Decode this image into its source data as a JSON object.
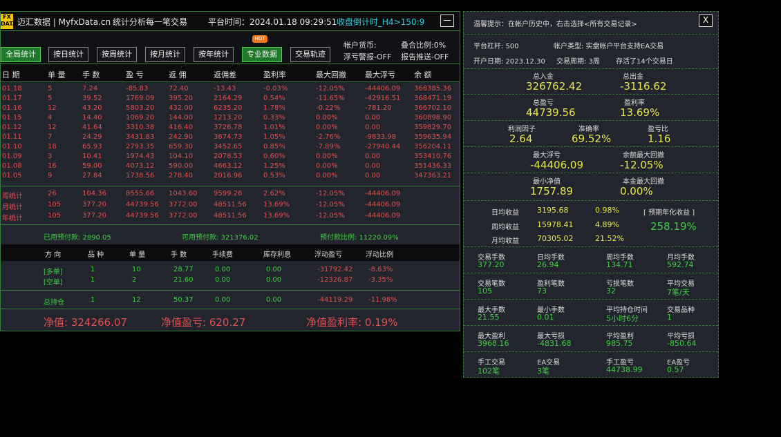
{
  "title": {
    "logo_top": "FX",
    "logo_bottom": "DATA",
    "app_name": "迈汇数据 | MyfxData.cn",
    "slogan": "统计分析每一笔交易",
    "server_time": "平台时间：2024.01.18 09:29:51",
    "countdown": "收盘倒计时_H4>150:9",
    "minimize": "—"
  },
  "buttons": [
    {
      "label": "全局统计",
      "active": true
    },
    {
      "label": "按日统计",
      "active": false
    },
    {
      "label": "按周统计",
      "active": false
    },
    {
      "label": "按月统计",
      "active": false
    },
    {
      "label": "按年统计",
      "active": false
    },
    {
      "label": "专业数据",
      "active": true
    },
    {
      "label": "交易轨迹",
      "active": false
    }
  ],
  "hot_badge": "HOT",
  "account_info": {
    "currency": "帐户货币:",
    "combine_ratio": "叠合比例:0%",
    "float_alert": "浮亏警报-OFF",
    "report_push": "报告推送-OFF"
  },
  "table": {
    "headers": [
      "日 期",
      "单 量",
      "手 数",
      "盈 亏",
      "返 佣",
      "返佣差",
      "盈利率",
      "最大回撤",
      "最大浮亏",
      "余 额"
    ],
    "rows": [
      [
        "01.18",
        "5",
        "7.24",
        "-85.83",
        "72.40",
        "-13.43",
        "-0.03%",
        "-12.05%",
        "-44406.09",
        "368385.36"
      ],
      [
        "01.17",
        "5",
        "39.52",
        "1769.09",
        "395.20",
        "2164.29",
        "0.54%",
        "-11.65%",
        "-42916.51",
        "368471.19"
      ],
      [
        "01.16",
        "12",
        "43.20",
        "5803.20",
        "432.00",
        "6235.20",
        "1.78%",
        "-0.22%",
        "-781.20",
        "366702.10"
      ],
      [
        "01.15",
        "4",
        "14.40",
        "1069.20",
        "144.00",
        "1213.20",
        "0.33%",
        "0.00%",
        "0.00",
        "360898.90"
      ],
      [
        "01.12",
        "12",
        "41.64",
        "3310.38",
        "416.40",
        "3726.78",
        "1.01%",
        "0.00%",
        "0.00",
        "359829.70"
      ],
      [
        "01.11",
        "7",
        "24.29",
        "3431.83",
        "242.90",
        "3674.73",
        "1.05%",
        "-2.76%",
        "-9833.98",
        "359635.94"
      ],
      [
        "01.10",
        "18",
        "65.93",
        "2793.35",
        "659.30",
        "3452.65",
        "0.85%",
        "-7.89%",
        "-27940.44",
        "356204.11"
      ],
      [
        "01.09",
        "3",
        "10.41",
        "1974.43",
        "104.10",
        "2078.53",
        "0.60%",
        "0.00%",
        "0.00",
        "353410.76"
      ],
      [
        "01.08",
        "16",
        "59.00",
        "4073.12",
        "590.00",
        "4663.12",
        "1.25%",
        "0.00%",
        "0.00",
        "351436.33"
      ],
      [
        "01.05",
        "9",
        "27.84",
        "1738.56",
        "278.40",
        "2016.96",
        "0.53%",
        "0.00%",
        "0.00",
        "347363.21"
      ]
    ],
    "summary": [
      [
        "周统计",
        "26",
        "104.36",
        "8555.66",
        "1043.60",
        "9599.26",
        "2.62%",
        "-12.05%",
        "-44406.09"
      ],
      [
        "月统计",
        "105",
        "377.20",
        "44739.56",
        "3772.00",
        "48511.56",
        "13.69%",
        "-12.05%",
        "-44406.09"
      ],
      [
        "年统计",
        "105",
        "377.20",
        "44739.56",
        "3772.00",
        "48511.56",
        "13.69%",
        "-12.05%",
        "-44406.09"
      ]
    ]
  },
  "margin": {
    "used": "已用预付款:  2890.05",
    "free": "可用预付款:  321376.02",
    "ratio": "预付款比例:  11220.09%"
  },
  "positions": {
    "headers": [
      "方 向",
      "品 种",
      "单 量",
      "手 数",
      "手续费",
      "库存利息",
      "浮动盈亏",
      "浮动比例"
    ],
    "rows": [
      [
        "[多单]",
        "1",
        "10",
        "28.77",
        "0.00",
        "0.00",
        "-31792.42",
        "-8.63%"
      ],
      [
        "[空单]",
        "1",
        "2",
        "21.60",
        "0.00",
        "0.00",
        "-12326.87",
        "-3.35%"
      ]
    ],
    "total": [
      "总持仓",
      "1",
      "12",
      "50.37",
      "0.00",
      "0.00",
      "-44119.29",
      "-11.98%"
    ]
  },
  "equity": {
    "net": "净值:  324266.07",
    "pnl": "净值盈亏:  620.27",
    "rate": "净值盈利率:  0.19%"
  },
  "right": {
    "tip": "温馨提示：在帐户历史中，右击选择<所有交易记录>",
    "close": "X",
    "leverage": "平台杠杆:  500",
    "acct_type": "帐户类型:  实盘帐户",
    "ea_support": "平台支持EA交易",
    "open_date": "开户日期:  2023.12.30",
    "period": "交易周期:  3周",
    "days": "存活了14个交易日",
    "total_in_label": "总入金",
    "total_in": "326762.42",
    "total_out_label": "总出金",
    "total_out": "-3116.62",
    "total_pnl_label": "总盈亏",
    "total_pnl": "44739.56",
    "profit_rate_label": "盈利率",
    "profit_rate": "13.69%",
    "pf_label": "利润因子",
    "pf": "2.64",
    "acc_label": "准确率",
    "acc": "69.52%",
    "rr_label": "盈亏比",
    "rr": "1.16",
    "max_float_label": "最大浮亏",
    "max_float": "-44406.09",
    "bal_dd_label": "余额最大回撤",
    "bal_dd": "-12.05%",
    "min_eq_label": "最小净值",
    "min_eq": "1757.89",
    "cap_dd_label": "本金最大回撤",
    "cap_dd": "0.00%",
    "daily_label": "日均收益",
    "daily_v": "3195.68",
    "daily_p": "0.98%",
    "weekly_label": "周均收益",
    "weekly_v": "15978.41",
    "weekly_p": "4.89%",
    "monthly_label": "月均收益",
    "monthly_v": "70305.02",
    "monthly_p": "21.52%",
    "annual_label": "[ 预期年化收益 ]",
    "annual": "258.19%",
    "g1": [
      [
        "交易手数",
        "377.20"
      ],
      [
        "日均手数",
        "26.94"
      ],
      [
        "周均手数",
        "134.71"
      ],
      [
        "月均手数",
        "592.74"
      ]
    ],
    "g2": [
      [
        "交易笔数",
        "105"
      ],
      [
        "盈利笔数",
        "73"
      ],
      [
        "亏损笔数",
        "32"
      ],
      [
        "平均交易",
        "7笔/天"
      ]
    ],
    "g3": [
      [
        "最大手数",
        "21.55"
      ],
      [
        "最小手数",
        "0.01"
      ],
      [
        "平均持仓时间",
        "5小时6分"
      ],
      [
        "交易品种",
        "1"
      ]
    ],
    "g4": [
      [
        "最大盈利",
        "3968.16"
      ],
      [
        "最大亏损",
        "-4831.68"
      ],
      [
        "平均盈利",
        "985.75"
      ],
      [
        "平均亏损",
        "-850.64"
      ]
    ],
    "g5": [
      [
        "手工交易",
        "102笔"
      ],
      [
        "EA交易",
        "3笔"
      ],
      [
        "手工盈亏",
        "44738.99"
      ],
      [
        "EA盈亏",
        "0.57"
      ]
    ]
  }
}
